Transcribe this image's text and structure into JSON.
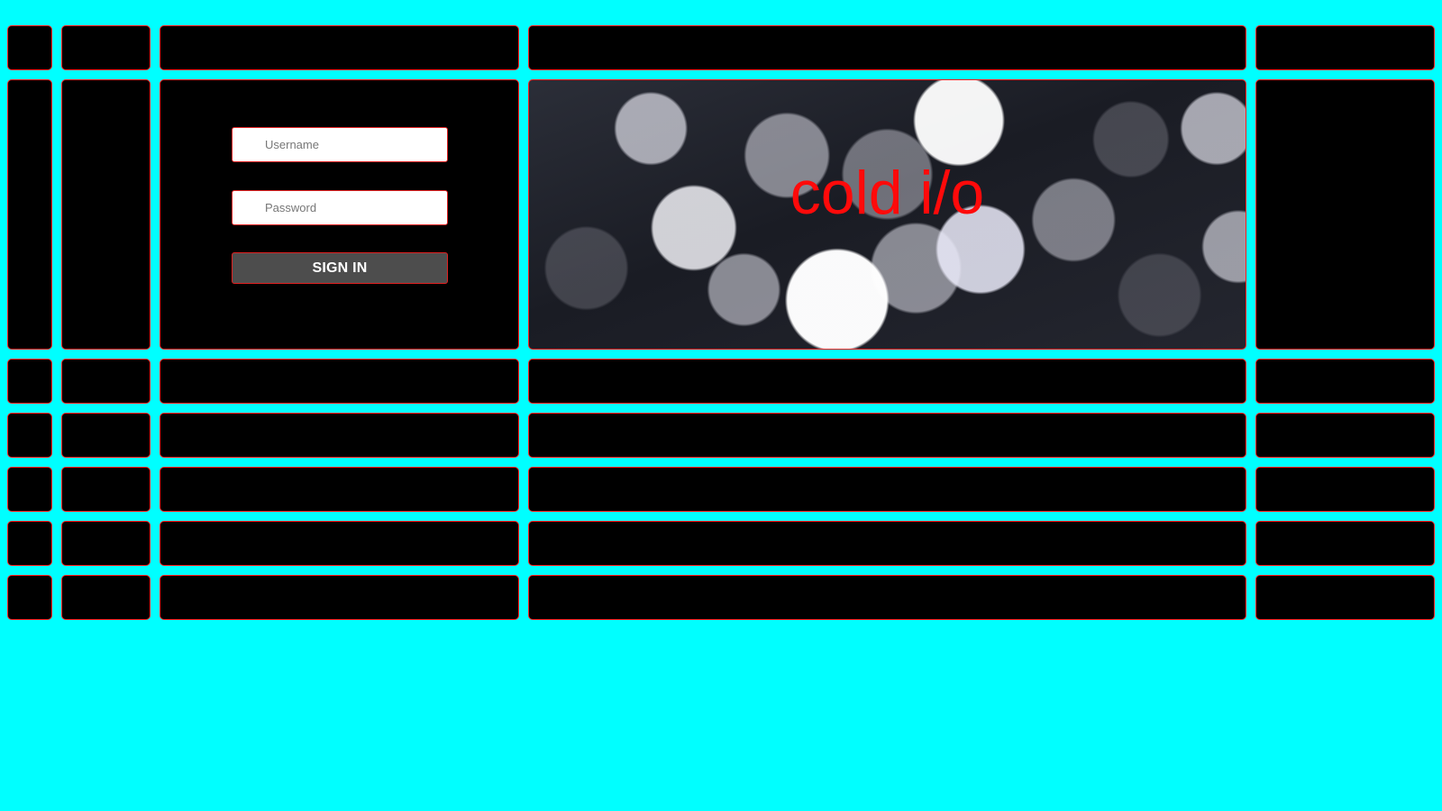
{
  "login": {
    "username_placeholder": "Username",
    "password_placeholder": "Password",
    "signin_label": "SIGN IN"
  },
  "banner": {
    "title": "cold i/o"
  },
  "colors": {
    "page_background": "#00ffff",
    "tile_background": "#000000",
    "tile_border": "#ff1a1a",
    "title_color": "#ff0a0a",
    "button_background": "#4d4d4d"
  }
}
